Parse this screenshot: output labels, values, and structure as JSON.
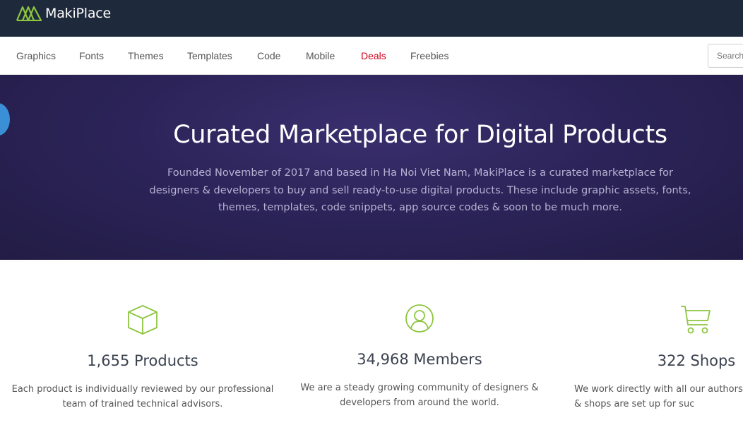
{
  "brand": {
    "name": "MakiPlace",
    "accent": "#8dc63f"
  },
  "nav": {
    "items": [
      {
        "label": "Graphics"
      },
      {
        "label": "Fonts"
      },
      {
        "label": "Themes"
      },
      {
        "label": "Templates"
      },
      {
        "label": "Code"
      },
      {
        "label": "Mobile"
      },
      {
        "label": "Deals"
      },
      {
        "label": "Freebies"
      }
    ],
    "search_placeholder": "Search"
  },
  "hero": {
    "title": "Curated Marketplace for Digital Products",
    "description": "Founded November of 2017 and based in Ha Noi Viet Nam, MakiPlace is a curated marketplace for designers & developers to buy and sell ready-to-use digital products. These include graphic assets, fonts, themes, templates, code snippets, app source codes & soon to be much more."
  },
  "stats": [
    {
      "icon": "box-icon",
      "title": "1,655 Products",
      "description": "Each product is individually reviewed by our professional team of trained technical advisors."
    },
    {
      "icon": "user-circle-icon",
      "title": "34,968 Members",
      "description": "We are a steady growing community of designers & developers from around the world."
    },
    {
      "icon": "shopping-cart-icon",
      "title": "322 Shops",
      "description": "We work directly with all our authors to & shops are set up for suc"
    }
  ]
}
